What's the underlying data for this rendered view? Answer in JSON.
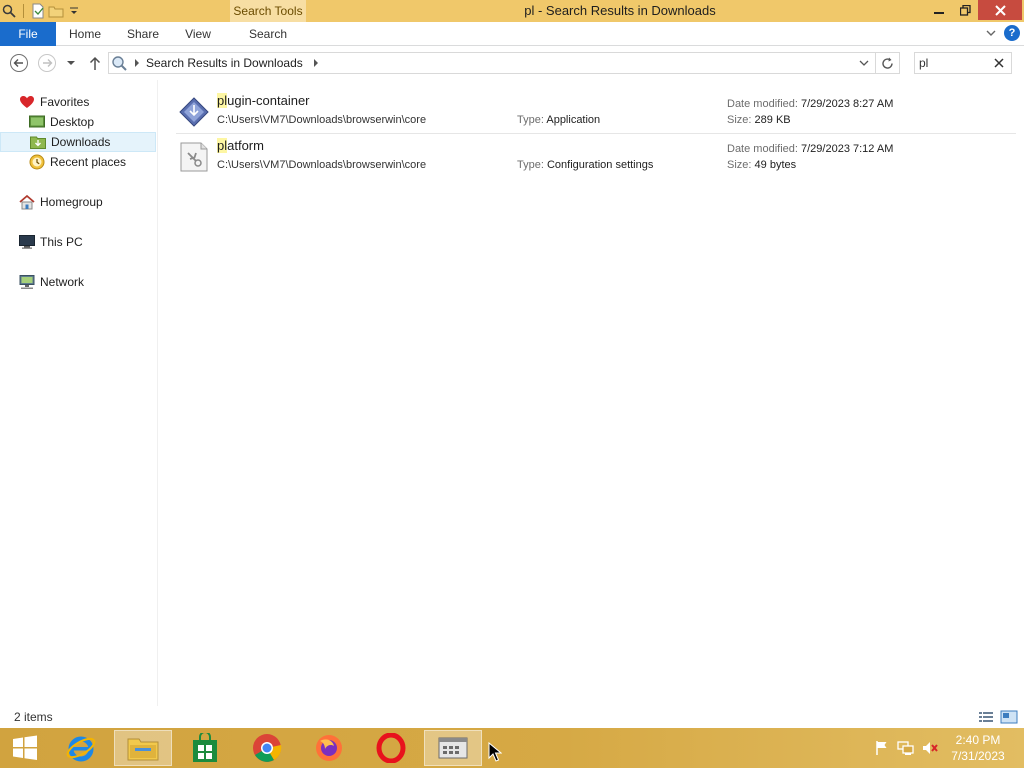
{
  "window": {
    "title": "pl - Search Results in Downloads",
    "contextual_tab": "Search Tools"
  },
  "ribbon": {
    "tabs": [
      "File",
      "Home",
      "Share",
      "View",
      "Search"
    ]
  },
  "address": {
    "path": "Search Results in Downloads"
  },
  "search": {
    "value": "pl"
  },
  "navpane": {
    "favorites": "Favorites",
    "desktop": "Desktop",
    "downloads": "Downloads",
    "recent": "Recent places",
    "homegroup": "Homegroup",
    "thispc": "This PC",
    "network": "Network"
  },
  "labels": {
    "type": "Type:",
    "date_modified": "Date modified:",
    "size": "Size:"
  },
  "results": [
    {
      "name_match": "pl",
      "name_rest": "ugin-container",
      "path": "C:\\Users\\VM7\\Downloads\\browserwin\\core",
      "type": "Application",
      "date": "7/29/2023 8:27 AM",
      "size": "289 KB"
    },
    {
      "name_match": "pl",
      "name_rest": "atform",
      "path": "C:\\Users\\VM7\\Downloads\\browserwin\\core",
      "type": "Configuration settings",
      "date": "7/29/2023 7:12 AM",
      "size": "49 bytes"
    }
  ],
  "status": {
    "count": "2 items"
  },
  "taskbar": {
    "time": "2:40 PM",
    "date": "7/31/2023"
  },
  "colors": {
    "titlebar": "#f0c86a",
    "file_tab": "#1a6ccc",
    "close": "#c74b3f",
    "highlight": "#fdf6a3",
    "selection": "#e5f3fb"
  }
}
